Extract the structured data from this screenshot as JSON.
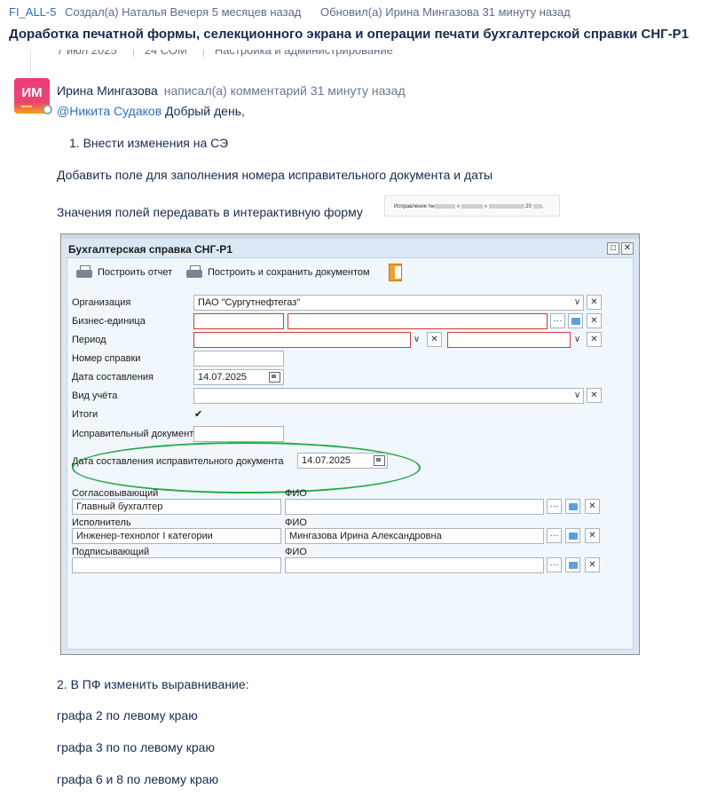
{
  "issue": {
    "key": "FI_ALL-5",
    "created": "Создал(а) Наталья Вечеря 5 месяцев назад",
    "updated": "Обновил(а) Ирина Мингазова 31 минуту назад",
    "title": "Доработка печатной формы, селекционного экрана и операции печати бухгалтерской справки СНГ-Р1"
  },
  "peek": {
    "date": "7 июл 2025",
    "mid": "24 СОМ",
    "category": "Настройка и администрирование"
  },
  "comment": {
    "avatar_initials": "ИМ",
    "author": "Ирина Мингазова",
    "action": "написал(а) комментарий 31 минуту назад",
    "mention": "@Никита Судаков",
    "greeting": "Добрый день,",
    "item1": "1. Внести изменения на СЭ",
    "add_field": "Добавить поле для заполнения номера исправительного документа и даты",
    "pass_values": "Значения полей передавать в интерактивную форму",
    "thumb_text": "Исправление №",
    "thumb_year": "20",
    "item2": "2. В ПФ изменить выравнивание:",
    "col2": "графа 2 по левому краю",
    "col3": "графа 3 по по левому краю",
    "col68": "графа 6 и 8 по левому краю"
  },
  "window": {
    "title": "Бухгалтерская справка СНГ-Р1",
    "tool_build": "Построить отчет",
    "tool_build_save": "Построить и сохранить документом",
    "labels": {
      "org": "Организация",
      "bu": "Бизнес-единица",
      "period": "Период",
      "ref_no": "Номер справки",
      "date": "Дата составления",
      "acc_type": "Вид учёта",
      "totals": "Итоги",
      "corr_doc": "Исправительный документ",
      "corr_date": "Дата составления исправительного документа",
      "approver": "Согласовывающий",
      "fio": "ФИО",
      "executor": "Исполнитель",
      "signer": "Подписывающий"
    },
    "values": {
      "org": "ПАО \"Сургутнефтегаз\"",
      "date": "14.07.2025",
      "corr_date": "14.07.2025",
      "approver": "Главный бухгалтер",
      "executor": "Инженер-технолог I категории",
      "executor_fio": "Мингазова  Ирина Александровна",
      "totals_checked": "✔"
    }
  },
  "colors": {
    "link": "#2f6fba",
    "required_border": "#d23b3b",
    "highlight_oval": "#26a844"
  }
}
